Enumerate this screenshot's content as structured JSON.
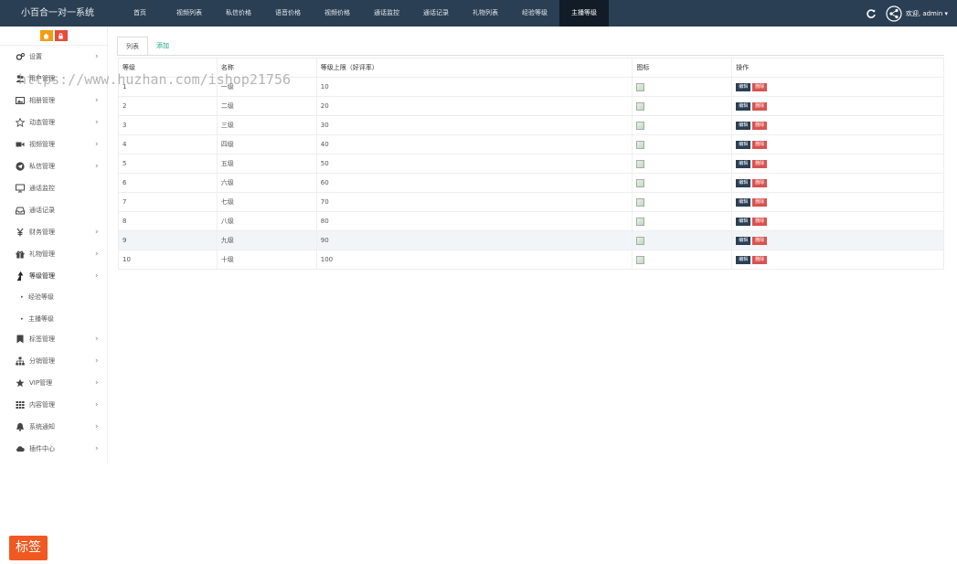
{
  "app": {
    "title": "小百合一对一系统"
  },
  "nav": [
    {
      "label": "首页"
    },
    {
      "label": "视频列表"
    },
    {
      "label": "私信价格"
    },
    {
      "label": "语音价格"
    },
    {
      "label": "视频价格"
    },
    {
      "label": "通话监控"
    },
    {
      "label": "通话记录"
    },
    {
      "label": "礼物列表"
    },
    {
      "label": "经验等级"
    },
    {
      "label": "主播等级",
      "active": true
    }
  ],
  "user": {
    "greeting": "欢迎, admin ▾"
  },
  "sidebar": {
    "items": [
      {
        "label": "设置",
        "icon": "gears-icon",
        "chevron": "›"
      },
      {
        "label": "用户管理",
        "icon": "users-icon",
        "chevron": "›"
      },
      {
        "label": "相册管理",
        "icon": "image-icon",
        "chevron": "›"
      },
      {
        "label": "动态管理",
        "icon": "star-outline-icon",
        "chevron": "›"
      },
      {
        "label": "视频管理",
        "icon": "video-camera-icon",
        "chevron": "›"
      },
      {
        "label": "私信管理",
        "icon": "telegram-icon",
        "chevron": "›"
      },
      {
        "label": "通话监控",
        "icon": "monitor-icon",
        "chevron": ""
      },
      {
        "label": "通话记录",
        "icon": "tray-icon",
        "chevron": ""
      },
      {
        "label": "财务管理",
        "icon": "yen-icon",
        "chevron": "›"
      },
      {
        "label": "礼物管理",
        "icon": "gift-icon",
        "chevron": "›"
      },
      {
        "label": "等级管理",
        "icon": "level-up-icon",
        "chevron": "›"
      },
      {
        "label": "标签管理",
        "icon": "bookmark-icon",
        "chevron": "›"
      },
      {
        "label": "分销管理",
        "icon": "sitemap-icon",
        "chevron": "›"
      },
      {
        "label": "VIP管理",
        "icon": "star-icon",
        "chevron": "›"
      },
      {
        "label": "内容管理",
        "icon": "grid-icon",
        "chevron": "›"
      },
      {
        "label": "系统通知",
        "icon": "bell-icon",
        "chevron": "›"
      },
      {
        "label": "插件中心",
        "icon": "cloud-icon",
        "chevron": "›"
      }
    ],
    "sub_items": [
      {
        "label": "经验等级",
        "marker": "▸"
      },
      {
        "label": "主播等级",
        "marker": "▸"
      }
    ]
  },
  "tabs": [
    {
      "label": "列表"
    },
    {
      "label": "添加"
    }
  ],
  "table": {
    "headers": [
      "等级",
      "名称",
      "等级上限（好评率）",
      "图标",
      "操作"
    ],
    "edit_label": "编辑",
    "delete_label": "删除",
    "rows": [
      {
        "level": "1",
        "name": "一级",
        "limit": "10"
      },
      {
        "level": "2",
        "name": "二级",
        "limit": "20"
      },
      {
        "level": "3",
        "name": "三级",
        "limit": "30"
      },
      {
        "level": "4",
        "name": "四级",
        "limit": "40"
      },
      {
        "level": "5",
        "name": "五级",
        "limit": "50"
      },
      {
        "level": "6",
        "name": "六级",
        "limit": "60"
      },
      {
        "level": "7",
        "name": "七级",
        "limit": "70"
      },
      {
        "level": "8",
        "name": "八级",
        "limit": "80"
      },
      {
        "level": "9",
        "name": "九级",
        "limit": "90"
      },
      {
        "level": "10",
        "name": "十级",
        "limit": "100"
      }
    ],
    "highlighted_row": 8
  },
  "watermark": {
    "text": "https://www.huzhan.com/ishop21756"
  },
  "tag_badge": {
    "label": "标签"
  },
  "colors": {
    "topbar": "#2a3f54",
    "active_nav": "#111c26",
    "edit_button": "#2a3f54",
    "delete_button": "#d9534f",
    "tab_link": "#16a085",
    "tag_badge": "#f0591f"
  }
}
